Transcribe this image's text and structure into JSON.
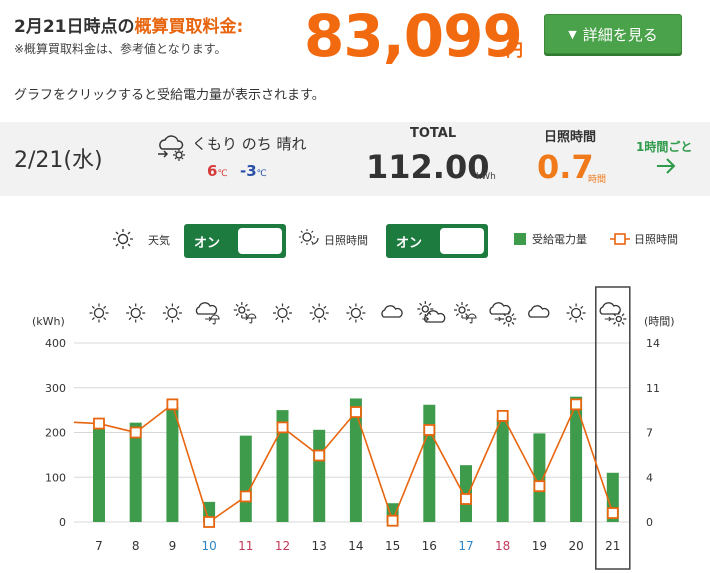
{
  "header": {
    "headline_prefix": "2月21日時点の",
    "headline_highlight": "概算買取料金:",
    "note": "※概算買取料金は、参考値となります。",
    "amount": "83,099",
    "amount_unit": "円",
    "detail_button": "詳細を見る"
  },
  "hint": "グラフをクリックすると受給電力量が表示されます。",
  "summary": {
    "date": "2/21(水)",
    "weather_text": "くもり のち 晴れ",
    "temp_high": "6",
    "temp_low": "-3",
    "temp_unit": "℃",
    "total_label": "TOTAL",
    "total_value": "112.00",
    "total_unit": "kWh",
    "sunshine_label": "日照時間",
    "sunshine_value": "0.7",
    "sunshine_unit": "時間",
    "hourly_link": "1時間ごと",
    "weather_icon": "cloudy-then-sunny-icon"
  },
  "toggles": {
    "weather_label": "天気",
    "weather_state": "オン",
    "sunshine_label": "日照時間",
    "sunshine_state": "オン",
    "legend_power": "受給電力量",
    "legend_sunshine": "日照時間"
  },
  "colors": {
    "bar": "#3f9b4c",
    "line": "#e8660f",
    "accent_orange": "#f26a10",
    "toggle_green": "#1e7b3f",
    "saturday": "#2f86c6",
    "sunday": "#c43a5a"
  },
  "chart_data": {
    "type": "bar",
    "categories": [
      "7",
      "8",
      "9",
      "10",
      "11",
      "12",
      "13",
      "14",
      "15",
      "16",
      "17",
      "18",
      "19",
      "20",
      "21"
    ],
    "category_kinds": [
      "weekday",
      "weekday",
      "weekday",
      "saturday",
      "sunday",
      "sunday",
      "weekday",
      "weekday",
      "weekday",
      "weekday",
      "saturday",
      "sunday",
      "weekday",
      "weekday",
      "weekday"
    ],
    "weather_icons": [
      "sunny",
      "sunny",
      "sunny",
      "cloudy-rain",
      "sunny-rain",
      "sunny",
      "sunny",
      "sunny",
      "cloudy",
      "sunny-cloudy",
      "sunny-rain",
      "cloudy-sunny",
      "cloudy",
      "sunny",
      "cloudy-sunny"
    ],
    "series": [
      {
        "name": "受給電力量",
        "axis": "left",
        "values": [
          208,
          222,
          257,
          45,
          193,
          250,
          206,
          276,
          42,
          262,
          127,
          230,
          198,
          280,
          110
        ]
      },
      {
        "name": "日照時間",
        "axis": "right",
        "values": [
          7.7,
          7.0,
          9.2,
          0.0,
          2.0,
          7.4,
          5.2,
          8.6,
          0.1,
          7.2,
          1.8,
          8.3,
          2.8,
          9.2,
          0.7
        ]
      }
    ],
    "line_start_value": 7.8,
    "ylabel_left": "(kWh)",
    "ylabel_right": "(時間)",
    "yticks_left": [
      0,
      100,
      200,
      300,
      400
    ],
    "yticks_right": [
      0,
      4,
      7,
      11,
      14
    ],
    "ylim_left": [
      0,
      400
    ],
    "ylim_right": [
      0,
      14
    ],
    "selected_category": "21"
  }
}
